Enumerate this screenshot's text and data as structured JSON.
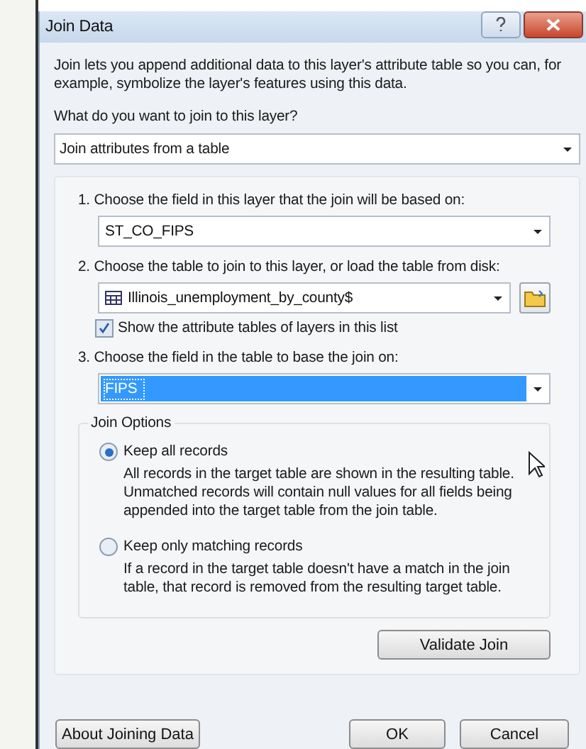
{
  "window": {
    "title": "Join Data"
  },
  "intro": "Join lets you append additional data to this layer's attribute table so you can, for example, symbolize the layer's features using this data.",
  "question": "What do you want to join to this layer?",
  "join_type": {
    "value": "Join attributes from a table"
  },
  "steps": [
    {
      "label": "1. Choose the field in this layer that the join will be based on:",
      "field": {
        "value": "ST_CO_FIPS",
        "selected": false,
        "table_icon": false
      },
      "browse_button": false
    },
    {
      "label": "2. Choose the table to join to this layer, or load the table from disk:",
      "field": {
        "value": "Illinois_unemployment_by_county$",
        "selected": false,
        "table_icon": true
      },
      "browse_button": true,
      "checkbox": {
        "label": "Show the attribute tables of layers in this list",
        "checked": true
      }
    },
    {
      "label": "3. Choose the field in the table to base the join on:",
      "field": {
        "value": "FIPS",
        "selected": true,
        "table_icon": false
      },
      "browse_button": false
    }
  ],
  "join_options": {
    "title": "Join Options",
    "options": [
      {
        "label": "Keep all records",
        "selected": true,
        "description": "All records in the target table are shown in the resulting table. Unmatched records will contain null values for all fields being appended into the target table from the join table."
      },
      {
        "label": "Keep only matching records",
        "selected": false,
        "description": "If a record in the target table doesn't have a match in the join table, that record is removed from the resulting target table."
      }
    ]
  },
  "validate_button": "Validate Join",
  "about_button": "About Joining Data",
  "buttons": [
    "OK",
    "Cancel"
  ]
}
